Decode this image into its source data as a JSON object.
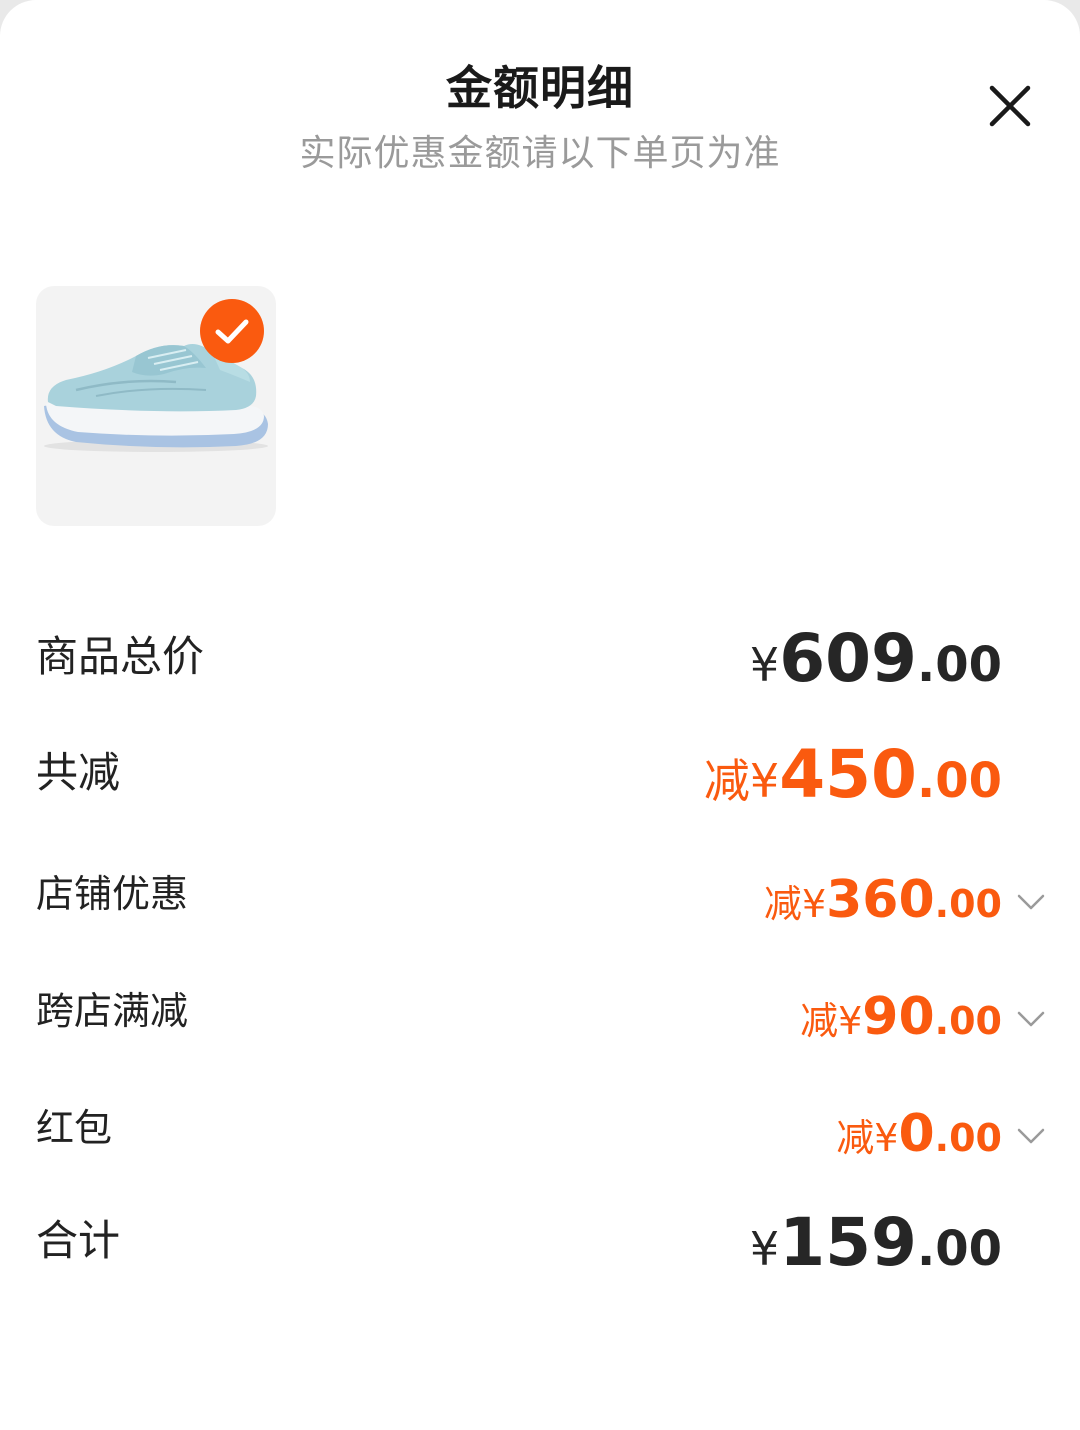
{
  "header": {
    "title": "金额明细",
    "subtitle": "实际优惠金额请以下单页为准"
  },
  "icons": {
    "close": "close-icon",
    "check": "check-icon",
    "chevron": "chevron-down-icon"
  },
  "colors": {
    "accent": "#fa5a0f",
    "text": "#222222",
    "subtle": "#9a9a9a"
  },
  "product": {
    "selected": true,
    "image": "light-blue running shoe"
  },
  "rows": [
    {
      "label": "商品总价",
      "prefix": "",
      "currency": "¥",
      "integer": "609",
      "decimal": ".00"
    },
    {
      "label": "共减",
      "prefix": "减",
      "currency": "¥",
      "integer": "450",
      "decimal": ".00"
    },
    {
      "label": "店铺优惠",
      "prefix": "减",
      "currency": "¥",
      "integer": "360",
      "decimal": ".00"
    },
    {
      "label": "跨店满减",
      "prefix": "减",
      "currency": "¥",
      "integer": "90",
      "decimal": ".00"
    },
    {
      "label": "红包",
      "prefix": "减",
      "currency": "¥",
      "integer": "0",
      "decimal": ".00"
    },
    {
      "label": "合计",
      "prefix": "",
      "currency": "¥",
      "integer": "159",
      "decimal": ".00"
    }
  ]
}
